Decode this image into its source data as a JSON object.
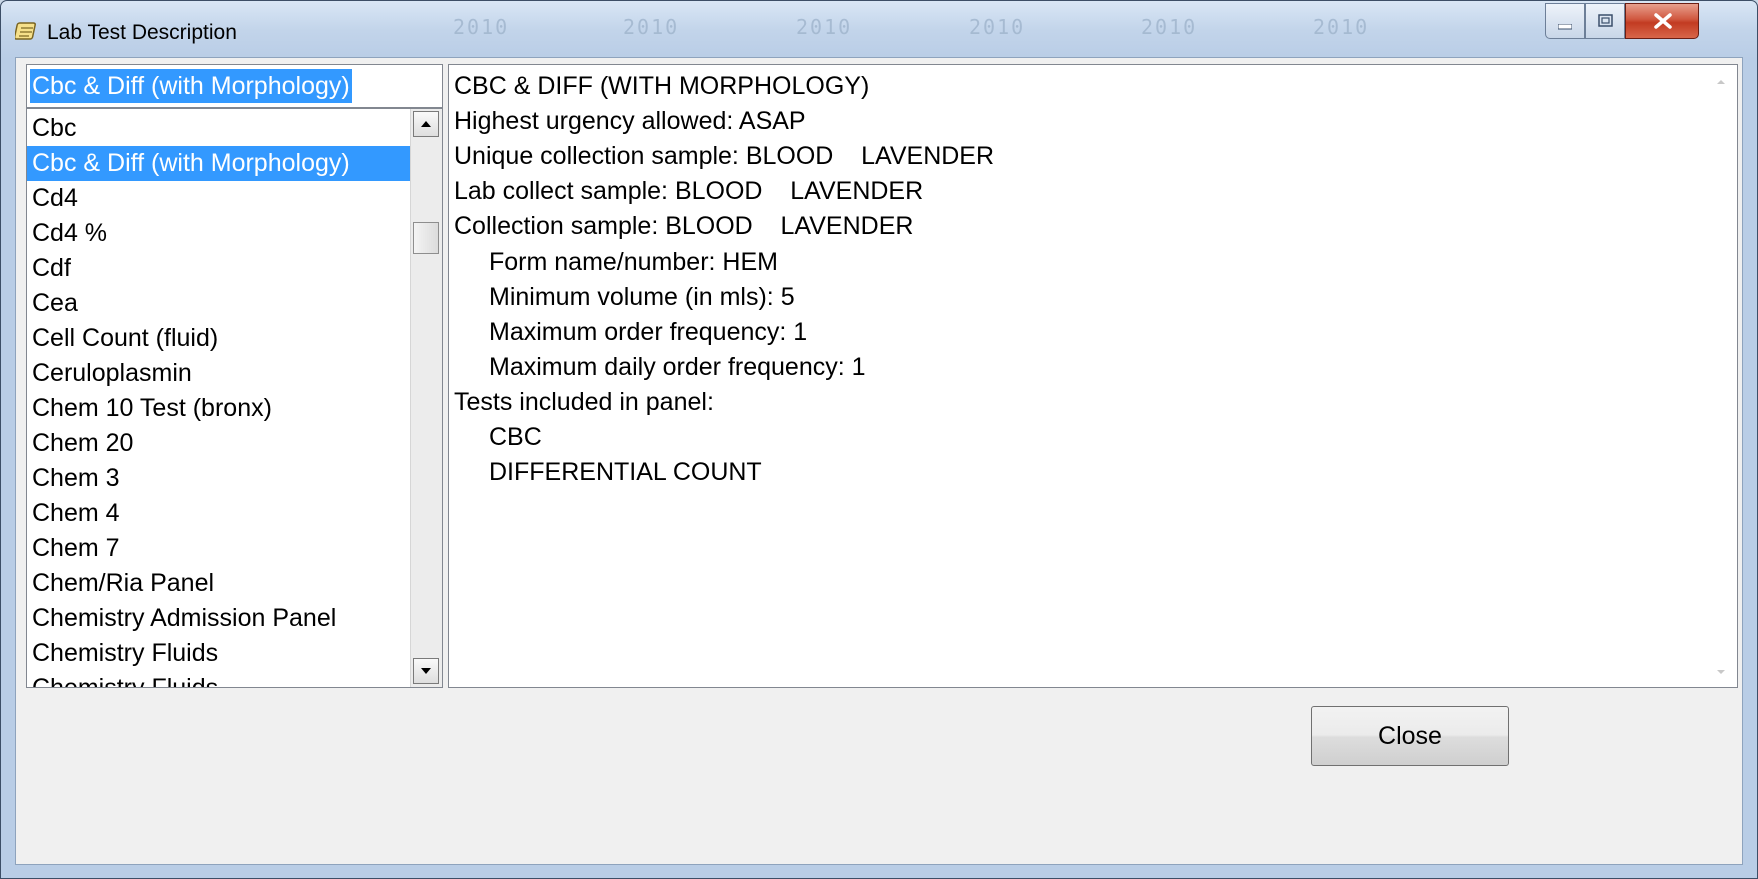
{
  "window": {
    "title": "Lab Test Description",
    "icon": "notepad-icon"
  },
  "controls": {
    "minimize_icon": "minimize-icon",
    "maximize_icon": "maximize-icon",
    "close_icon": "close-icon"
  },
  "background_text": [
    "2010",
    "2010",
    "2010",
    "2010",
    "2010",
    "2010"
  ],
  "search": {
    "value": "Cbc & Diff (with Morphology)"
  },
  "list": {
    "items": [
      "Cbc",
      "Cbc & Diff (with Morphology)",
      "Cd4",
      "Cd4 %",
      "Cdf",
      "Cea",
      "Cell Count (fluid)",
      "Ceruloplasmin",
      "Chem 10 Test (bronx)",
      "Chem 20",
      "Chem 3",
      "Chem 4",
      "Chem 7",
      "Chem/Ria Panel",
      "Chemistry Admission Panel",
      "Chemistry Fluids",
      "Chemistry Fluids"
    ],
    "selected": "Cbc & Diff (with Morphology)"
  },
  "detail": {
    "lines": [
      "CBC & DIFF (WITH MORPHOLOGY)",
      "Highest urgency allowed: ASAP",
      "Unique collection sample: BLOOD    LAVENDER",
      "Lab collect sample: BLOOD    LAVENDER",
      "Collection sample: BLOOD    LAVENDER",
      "Form name/number: HEM",
      "Minimum volume (in mls): 5",
      "Maximum order frequency: 1",
      "Maximum daily order frequency: 1",
      "Tests included in panel:",
      "CBC",
      "DIFFERENTIAL COUNT"
    ]
  },
  "buttons": {
    "close_label": "Close"
  },
  "colors": {
    "selection": "#3399ff",
    "titlebar": "#c2d4ea",
    "close_button_red": "#c23b22"
  }
}
